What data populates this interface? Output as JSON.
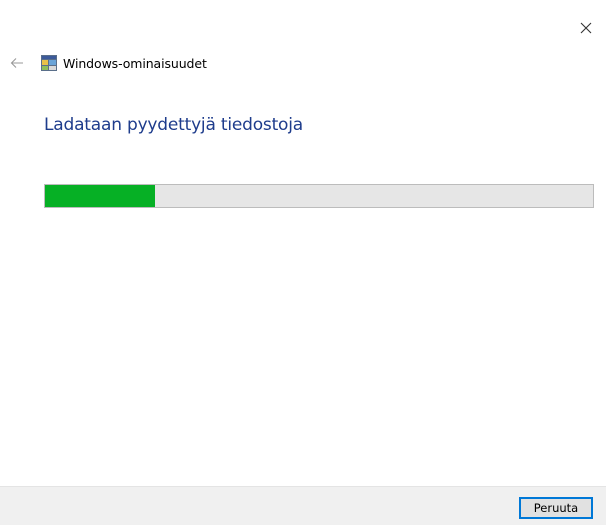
{
  "window": {
    "title": "Windows-ominaisuudet",
    "close_icon": "close-icon",
    "back_icon": "back-arrow-icon",
    "app_icon": "windows-features-icon"
  },
  "main": {
    "heading": "Ladataan pyydettyjä tiedostoja",
    "progress": {
      "value": 0.2,
      "fill_color": "#06b025",
      "track_color": "#e6e6e6"
    }
  },
  "footer": {
    "cancel_label": "Peruuta"
  },
  "colors": {
    "heading": "#1e3c8c",
    "button_border": "#0078d7",
    "footer_bg": "#f0f0f0"
  }
}
